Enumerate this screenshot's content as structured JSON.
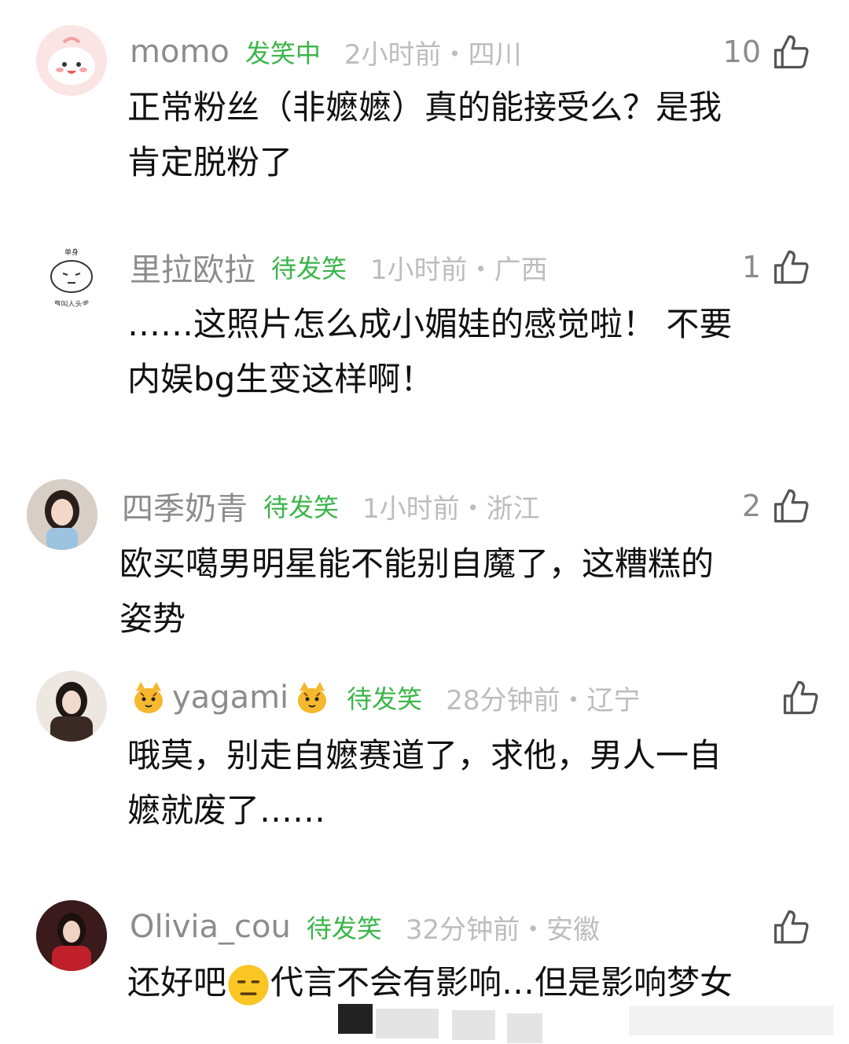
{
  "comments": [
    {
      "username": "momo",
      "tag": "发笑中",
      "time": "2小时前・四川",
      "likes": "10",
      "lines": [
        "正常粉丝（非嬷嬷）真的能接受么？是我",
        "肯定脱粉了"
      ]
    },
    {
      "username": "里拉欧拉",
      "tag": "待发笑",
      "time": "1小时前・广西",
      "likes": "1",
      "avatar_top": "单身",
      "avatar_bottom": "真叫人头秃",
      "lines": [
        "……这照片怎么成小媚娃的感觉啦！ 不要",
        "内娱bg生变这样啊！"
      ]
    },
    {
      "username": "四季奶青",
      "tag": "待发笑",
      "time": "1小时前・浙江",
      "likes": "2",
      "lines": [
        "欧买噶男明星能不能别自魔了，这糟糕的",
        "姿势"
      ]
    },
    {
      "username": "yagami",
      "tag": "待发笑",
      "time": "28分钟前・辽宁",
      "likes": "",
      "lines": [
        "哦莫，别走自嬷赛道了，求他，男人一自",
        "嬷就废了……"
      ]
    },
    {
      "username": "Olivia_cou",
      "tag": "待发笑",
      "time": "32分钟前・安徽",
      "likes": "",
      "lines_a": "还好吧",
      "lines_b": "代言不会有影响…但是影响梦女"
    }
  ],
  "icons": {
    "like": "thumbs-up-icon",
    "cat_emoji": "tiger-cat-emoji-icon",
    "face_emoji": "expressionless-face-emoji-icon"
  },
  "colors": {
    "username": "#8c8c8c",
    "tag": "#3bb54a",
    "time": "#bdbdbd"
  }
}
